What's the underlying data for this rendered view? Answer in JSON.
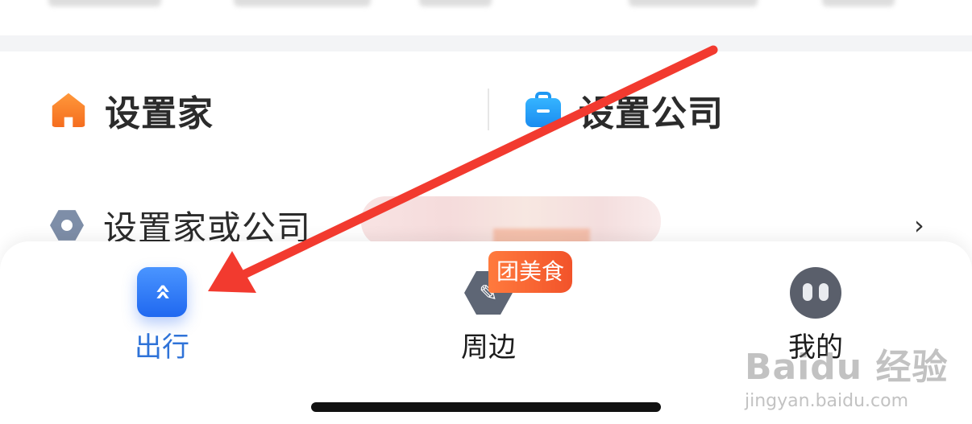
{
  "shortcuts": {
    "home_label": "设置家",
    "company_label": "设置公司"
  },
  "setting_row": {
    "label": "设置家或公司",
    "chevron": "›"
  },
  "tabbar": {
    "tabs": [
      {
        "label": "出行",
        "icon": "double-chevron-up-icon",
        "active": true
      },
      {
        "label": "周边",
        "icon": "compass-hexagon-icon",
        "active": false
      },
      {
        "label": "我的",
        "icon": "profile-face-icon",
        "active": false
      }
    ],
    "badge_text": "团美食"
  },
  "icons": {
    "chuxing_glyph": "»",
    "nearby_glyph": "✎"
  },
  "watermark": {
    "main": "Baidu 经验",
    "sub": "jingyan.baidu.com"
  },
  "colors": {
    "active_tab": "#2f73d8",
    "annotation_arrow": "#f23a2f",
    "badge": "#f2532a"
  }
}
